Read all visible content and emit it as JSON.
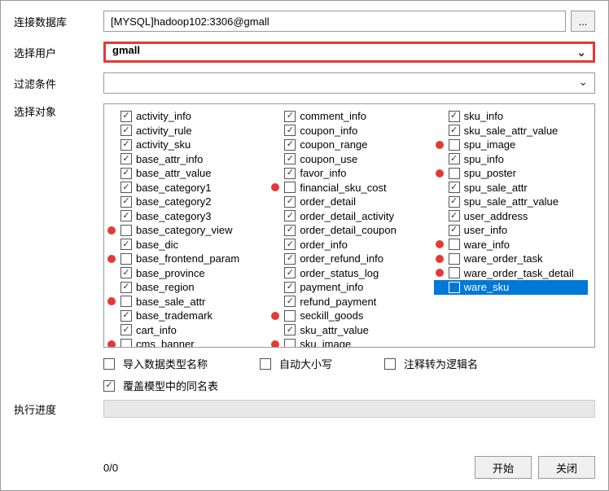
{
  "labels": {
    "database": "连接数据库",
    "user": "选择用户",
    "filter": "过滤条件",
    "objects": "选择对象",
    "progress": "执行进度"
  },
  "fields": {
    "database_value": "[MYSQL]hadoop102:3306@gmall",
    "browse": "...",
    "user_value": "gmall",
    "filter_value": ""
  },
  "tables": {
    "col1": [
      {
        "name": "activity_info",
        "checked": true,
        "dot": false
      },
      {
        "name": "activity_rule",
        "checked": true,
        "dot": false
      },
      {
        "name": "activity_sku",
        "checked": true,
        "dot": false
      },
      {
        "name": "base_attr_info",
        "checked": true,
        "dot": false
      },
      {
        "name": "base_attr_value",
        "checked": true,
        "dot": false
      },
      {
        "name": "base_category1",
        "checked": true,
        "dot": false
      },
      {
        "name": "base_category2",
        "checked": true,
        "dot": false
      },
      {
        "name": "base_category3",
        "checked": true,
        "dot": false
      },
      {
        "name": "base_category_view",
        "checked": false,
        "dot": true
      },
      {
        "name": "base_dic",
        "checked": true,
        "dot": false
      },
      {
        "name": "base_frontend_param",
        "checked": false,
        "dot": true
      },
      {
        "name": "base_province",
        "checked": true,
        "dot": false
      },
      {
        "name": "base_region",
        "checked": true,
        "dot": false
      },
      {
        "name": "base_sale_attr",
        "checked": false,
        "dot": true
      },
      {
        "name": "base_trademark",
        "checked": true,
        "dot": false
      },
      {
        "name": "cart_info",
        "checked": true,
        "dot": false
      },
      {
        "name": "cms_banner",
        "checked": false,
        "dot": true
      }
    ],
    "col2": [
      {
        "name": "comment_info",
        "checked": true,
        "dot": false
      },
      {
        "name": "coupon_info",
        "checked": true,
        "dot": false
      },
      {
        "name": "coupon_range",
        "checked": true,
        "dot": false
      },
      {
        "name": "coupon_use",
        "checked": true,
        "dot": false
      },
      {
        "name": "favor_info",
        "checked": true,
        "dot": false
      },
      {
        "name": "financial_sku_cost",
        "checked": false,
        "dot": true
      },
      {
        "name": "order_detail",
        "checked": true,
        "dot": false
      },
      {
        "name": "order_detail_activity",
        "checked": true,
        "dot": false
      },
      {
        "name": "order_detail_coupon",
        "checked": true,
        "dot": false
      },
      {
        "name": "order_info",
        "checked": true,
        "dot": false
      },
      {
        "name": "order_refund_info",
        "checked": true,
        "dot": false
      },
      {
        "name": "order_status_log",
        "checked": true,
        "dot": false
      },
      {
        "name": "payment_info",
        "checked": true,
        "dot": false
      },
      {
        "name": "refund_payment",
        "checked": true,
        "dot": false
      },
      {
        "name": "seckill_goods",
        "checked": false,
        "dot": true
      },
      {
        "name": "sku_attr_value",
        "checked": true,
        "dot": false
      },
      {
        "name": "sku_image",
        "checked": false,
        "dot": true
      }
    ],
    "col3": [
      {
        "name": "sku_info",
        "checked": true,
        "dot": false
      },
      {
        "name": "sku_sale_attr_value",
        "checked": true,
        "dot": false
      },
      {
        "name": "spu_image",
        "checked": false,
        "dot": true
      },
      {
        "name": "spu_info",
        "checked": true,
        "dot": false
      },
      {
        "name": "spu_poster",
        "checked": false,
        "dot": true
      },
      {
        "name": "spu_sale_attr",
        "checked": true,
        "dot": false
      },
      {
        "name": "spu_sale_attr_value",
        "checked": true,
        "dot": false
      },
      {
        "name": "user_address",
        "checked": true,
        "dot": false
      },
      {
        "name": "user_info",
        "checked": true,
        "dot": false
      },
      {
        "name": "ware_info",
        "checked": false,
        "dot": true
      },
      {
        "name": "ware_order_task",
        "checked": false,
        "dot": true
      },
      {
        "name": "ware_order_task_detail",
        "checked": false,
        "dot": true
      },
      {
        "name": "ware_sku",
        "checked": false,
        "dot": false,
        "selected": true
      }
    ]
  },
  "options": {
    "import_type_name": "导入数据类型名称",
    "auto_case": "自动大小写",
    "comment_to_logical": "注释转为逻辑名",
    "overwrite_same": "覆盖模型中的同名表",
    "overwrite_checked": true
  },
  "footer": {
    "counter": "0/0",
    "start": "开始",
    "close": "关闭"
  }
}
